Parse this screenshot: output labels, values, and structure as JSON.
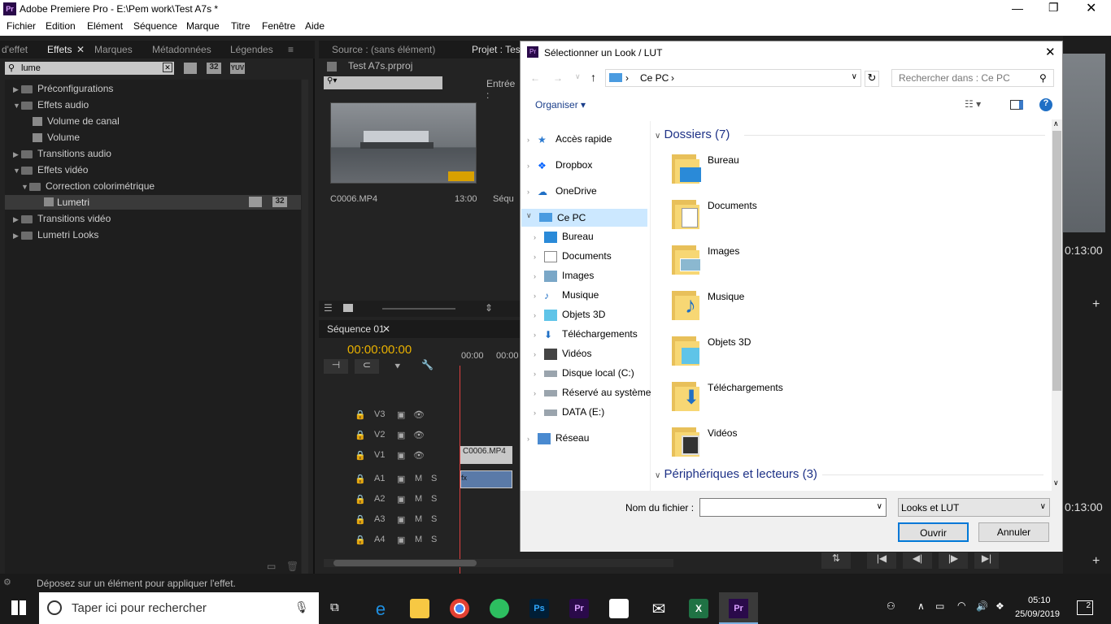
{
  "app": {
    "title": "Adobe Premiere Pro - E:\\Pem work\\Test A7s *",
    "icon": "Pr"
  },
  "menu": [
    "Fichier",
    "Edition",
    "Elément",
    "Séquence",
    "Marque",
    "Titre",
    "Fenêtre",
    "Aide"
  ],
  "effects_panel": {
    "tabs": [
      "d'effet",
      "Effets",
      "Marques",
      "Métadonnées",
      "Légendes"
    ],
    "search_value": "lume",
    "badges": [
      "32",
      "YUV"
    ],
    "tree": [
      {
        "label": "Préconfigurations",
        "level": 0,
        "expanded": false
      },
      {
        "label": "Effets audio",
        "level": 0,
        "expanded": true
      },
      {
        "label": "Volume de canal",
        "level": 1,
        "fx": true
      },
      {
        "label": "Volume",
        "level": 1,
        "fx": true
      },
      {
        "label": "Transitions audio",
        "level": 0,
        "expanded": false
      },
      {
        "label": "Effets vidéo",
        "level": 0,
        "expanded": true
      },
      {
        "label": "Correction colorimétrique",
        "level": 1,
        "expanded": true
      },
      {
        "label": "Lumetri",
        "level": 2,
        "fx": true,
        "selected": true
      },
      {
        "label": "Transitions vidéo",
        "level": 0,
        "expanded": false
      },
      {
        "label": "Lumetri Looks",
        "level": 0,
        "expanded": false
      }
    ],
    "lumetri_badge": "32"
  },
  "source_panel": {
    "tabs": [
      "Source : (sans élément)",
      "Projet : Tes"
    ],
    "project_file": "Test A7s.prproj",
    "entry_label": "Entrée :",
    "clip_name": "C0006.MP4",
    "clip_duration": "13:00",
    "seq_label": "Séqu"
  },
  "timeline": {
    "tab": "Séquence 01",
    "timecode": "00:00:00:00",
    "ruler": [
      "00:00",
      "00:00"
    ],
    "clip": "C0006.MP4",
    "video_tracks": [
      "V3",
      "V2",
      "V1"
    ],
    "audio_tracks": [
      "A1",
      "A2",
      "A3",
      "A4"
    ],
    "m": "M",
    "s": "S"
  },
  "right_panel": {
    "tc1": "0:13:00",
    "tc2": "0:13:00"
  },
  "status": {
    "text": "Déposez sur un élément pour appliquer l'effet."
  },
  "dialog": {
    "title": "Sélectionner un Look / LUT",
    "path": "Ce PC",
    "search_placeholder": "Rechercher dans : Ce PC",
    "organize": "Organiser",
    "nav": [
      "Accès rapide",
      "Dropbox",
      "OneDrive",
      "Ce PC",
      "Bureau",
      "Documents",
      "Images",
      "Musique",
      "Objets 3D",
      "Téléchargements",
      "Vidéos",
      "Disque local (C:)",
      "Réservé au système",
      "DATA (E:)",
      "Réseau"
    ],
    "group1": "Dossiers (7)",
    "folders": [
      "Bureau",
      "Documents",
      "Images",
      "Musique",
      "Objets 3D",
      "Téléchargements",
      "Vidéos"
    ],
    "group2": "Périphériques et lecteurs (3)",
    "filename_label": "Nom du fichier :",
    "filename_value": "",
    "filter": "Looks et LUT",
    "open": "Ouvrir",
    "cancel": "Annuler"
  },
  "taskbar": {
    "search_placeholder": "Taper ici pour rechercher",
    "time": "05:10",
    "date": "25/09/2019",
    "notif": "2"
  }
}
